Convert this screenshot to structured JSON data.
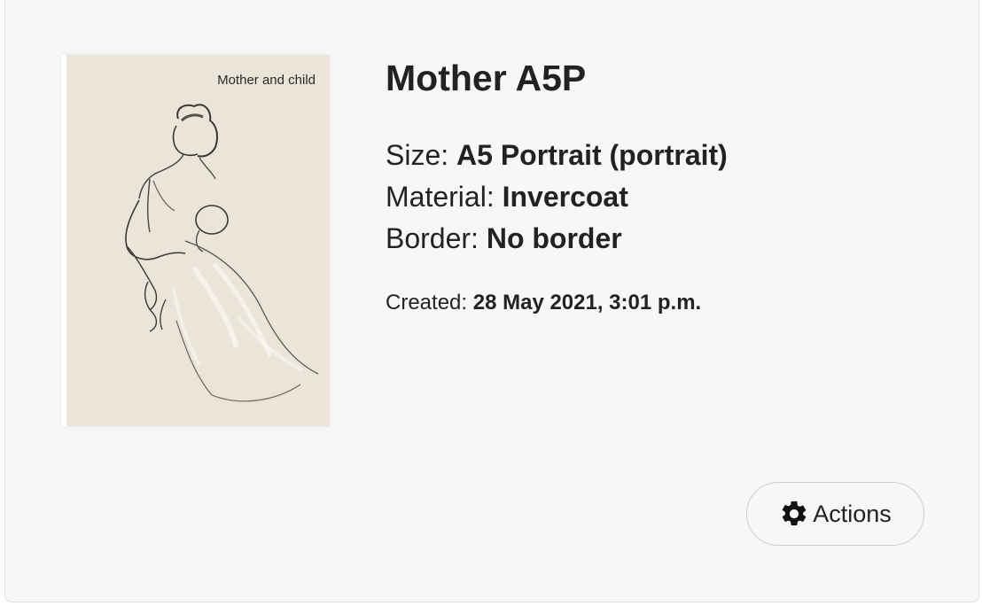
{
  "product": {
    "image_caption": "Mother and child",
    "title": "Mother A5P",
    "specs": [
      {
        "label": "Size:",
        "value": "A5 Portrait (portrait)"
      },
      {
        "label": "Material:",
        "value": "Invercoat"
      },
      {
        "label": "Border:",
        "value": "No border"
      }
    ],
    "created_label": "Created:",
    "created_value": "28 May 2021, 3:01 p.m."
  },
  "actions_button": {
    "label": "Actions",
    "icon": "gear-icon"
  },
  "colors": {
    "card_background": "#f7f7f7",
    "text": "#222222",
    "artwork_paper": "#ebe4d8"
  }
}
